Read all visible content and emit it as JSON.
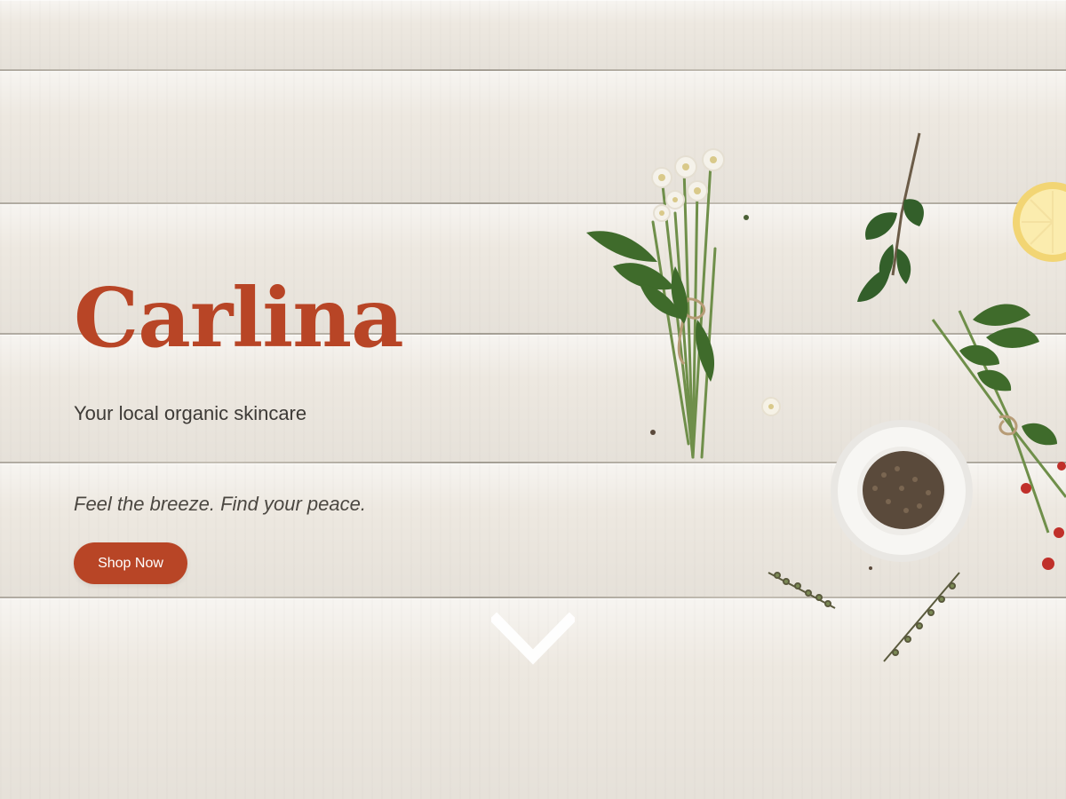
{
  "hero": {
    "brand": "Carlina",
    "tagline": "Your local organic skincare",
    "motto": "Feel the breeze. Find your peace.",
    "cta_label": "Shop Now"
  },
  "icons": {
    "scroll": "chevron-down-icon"
  },
  "colors": {
    "accent": "#b84526",
    "text": "#3d3a36",
    "background": "#ede8e0"
  }
}
